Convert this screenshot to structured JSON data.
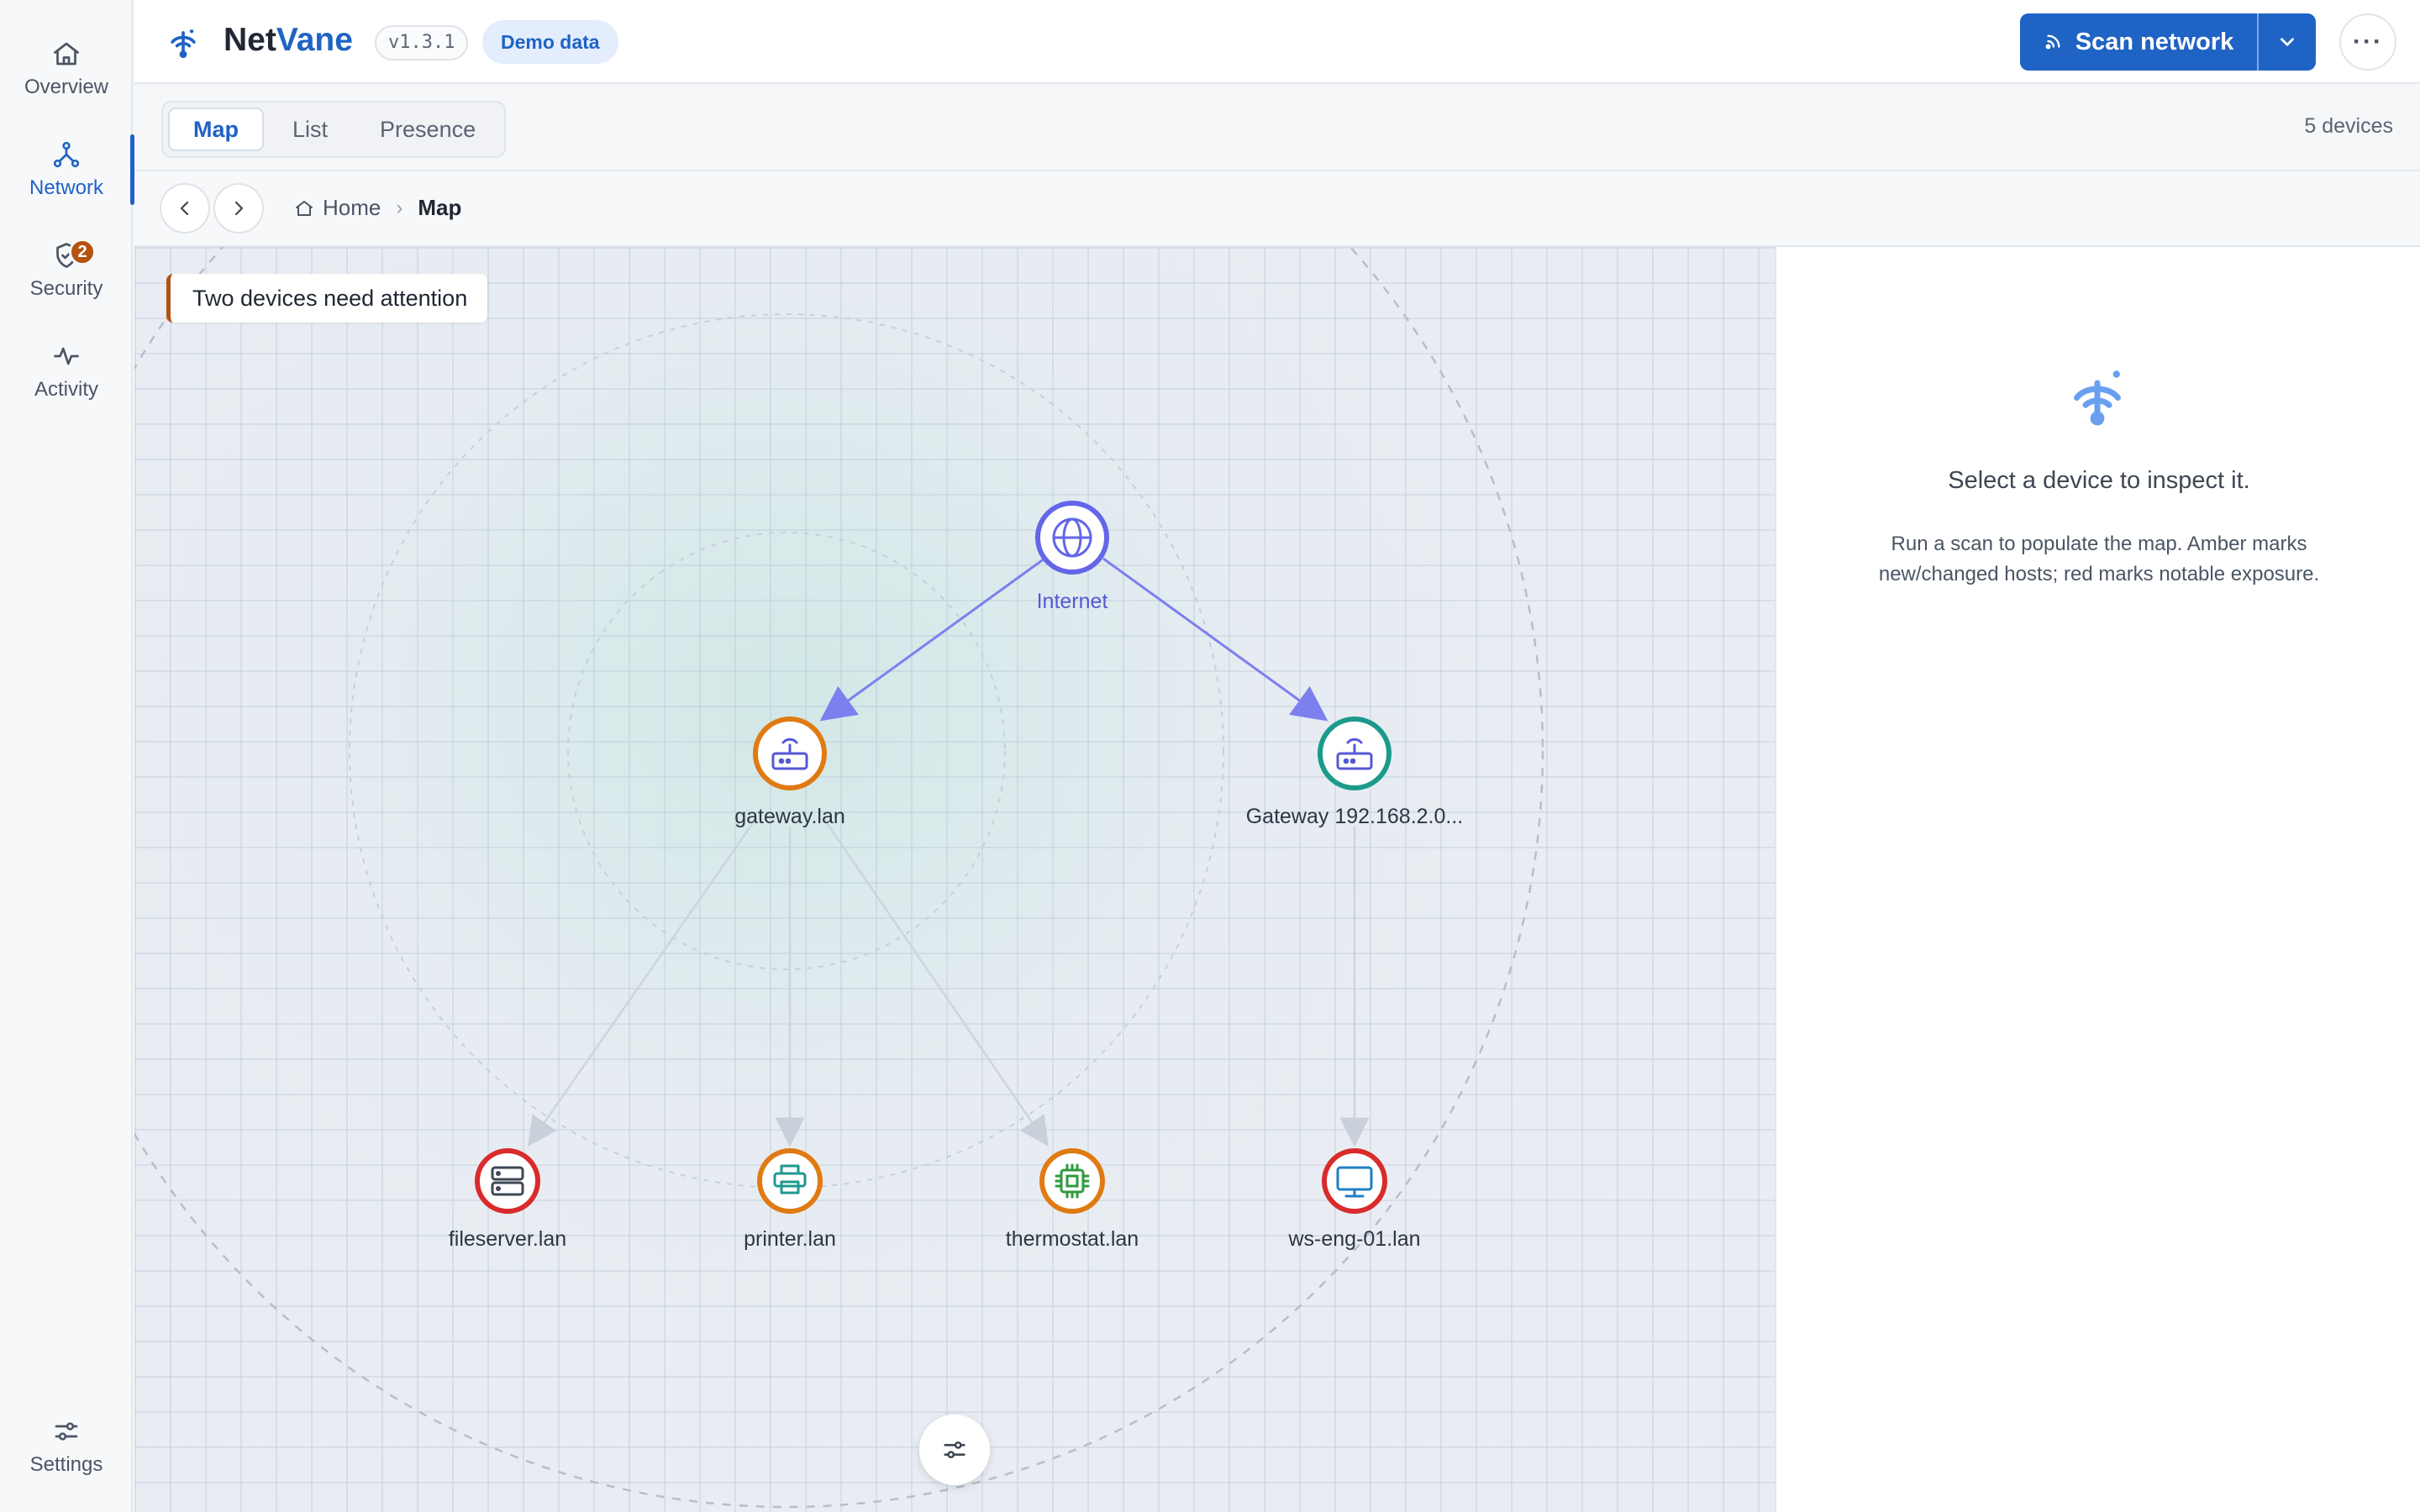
{
  "sidebar": {
    "items": [
      {
        "label": "Overview",
        "icon": "home-icon"
      },
      {
        "label": "Network",
        "icon": "network-icon",
        "active": true
      },
      {
        "label": "Security",
        "icon": "shield-icon",
        "badge": "2"
      },
      {
        "label": "Activity",
        "icon": "activity-icon"
      }
    ],
    "settings_label": "Settings"
  },
  "header": {
    "brand_prefix": "Net",
    "brand_suffix": "Vane",
    "version": "v1.3.1",
    "demo_chip": "Demo data",
    "scan_label": "Scan network",
    "more_label": "···"
  },
  "tabs": {
    "items": [
      {
        "label": "Map",
        "active": true
      },
      {
        "label": "List"
      },
      {
        "label": "Presence"
      }
    ],
    "device_count": "5 devices"
  },
  "breadcrumb": {
    "home": "Home",
    "separator": "›",
    "current": "Map"
  },
  "map": {
    "alert": "Two devices need attention",
    "nodes": [
      {
        "id": "internet",
        "label": "Internet",
        "type": "globe",
        "status_color": "#6366e8"
      },
      {
        "id": "gateway-lan",
        "label": "gateway.lan",
        "type": "router",
        "status_color": "#e07a12"
      },
      {
        "id": "gateway-2",
        "label": "Gateway 192.168.2.0...",
        "type": "router",
        "status_color": "#1c9a8c"
      },
      {
        "id": "fileserver",
        "label": "fileserver.lan",
        "type": "server",
        "status_color": "#d92b2b"
      },
      {
        "id": "printer",
        "label": "printer.lan",
        "type": "printer",
        "status_color": "#e07a12"
      },
      {
        "id": "thermostat",
        "label": "thermostat.lan",
        "type": "chip",
        "status_color": "#e07a12"
      },
      {
        "id": "ws-eng-01",
        "label": "ws-eng-01.lan",
        "type": "monitor",
        "status_color": "#d92b2b"
      }
    ]
  },
  "inspector": {
    "title": "Select a device to inspect it.",
    "hint": "Run a scan to populate the map. Amber marks new/changed hosts; red marks notable exposure."
  },
  "colors": {
    "accent": "#1f63c4",
    "amber": "#e07a12",
    "red": "#d92b2b",
    "teal": "#1c9a8c",
    "internet": "#6366e8",
    "badge": "#b5520f"
  }
}
